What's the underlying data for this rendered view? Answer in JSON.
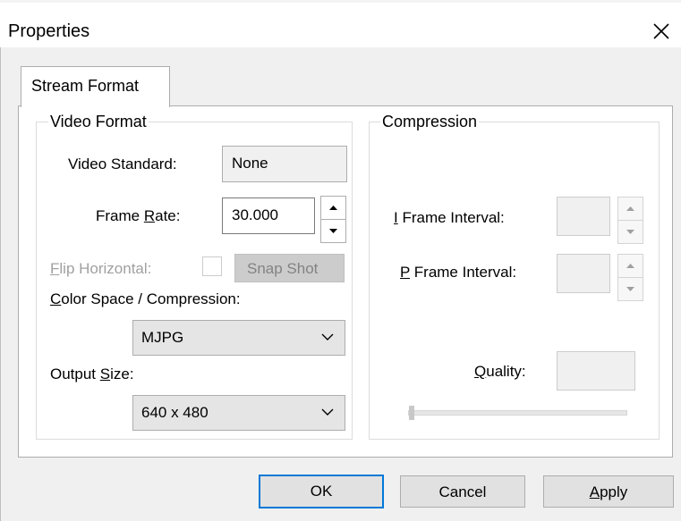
{
  "window": {
    "title": "Properties"
  },
  "tabs": [
    {
      "label": "Stream Format",
      "selected": true
    }
  ],
  "video_format": {
    "legend": "Video Format",
    "video_standard": {
      "label": "Video Standard:",
      "value": "None"
    },
    "frame_rate": {
      "label_pre": "Frame ",
      "label_u": "R",
      "label_post": "ate:",
      "value": "30.000"
    },
    "flip_horizontal": {
      "label_u": "F",
      "label_post": "lip Horizontal:",
      "checked": false
    },
    "snap_shot_label": "Snap Shot",
    "color_space": {
      "label_u": "C",
      "label_post": "olor Space / Compression:",
      "value": "MJPG"
    },
    "output_size": {
      "label_pre": "Output ",
      "label_u": "S",
      "label_post": "ize:",
      "value": "640 x 480"
    }
  },
  "compression": {
    "legend": "Compression",
    "i_frame": {
      "label_u": "I",
      "label_post": " Frame Interval:",
      "value": ""
    },
    "p_frame": {
      "label_u": "P",
      "label_post": " Frame Interval:",
      "value": ""
    },
    "quality": {
      "label_u": "Q",
      "label_post": "uality:",
      "value": ""
    }
  },
  "buttons": {
    "ok": "OK",
    "cancel": "Cancel",
    "apply_u": "A",
    "apply_post": "pply"
  },
  "colors": {
    "accent": "#0078d7",
    "dialog_bg": "#f0f0f0",
    "disabled_text": "#a0a0a0"
  },
  "icons": {
    "close": "close-icon",
    "spin_up": "arrow-up-icon",
    "spin_down": "arrow-down-icon",
    "dropdown": "chevron-down-icon"
  }
}
